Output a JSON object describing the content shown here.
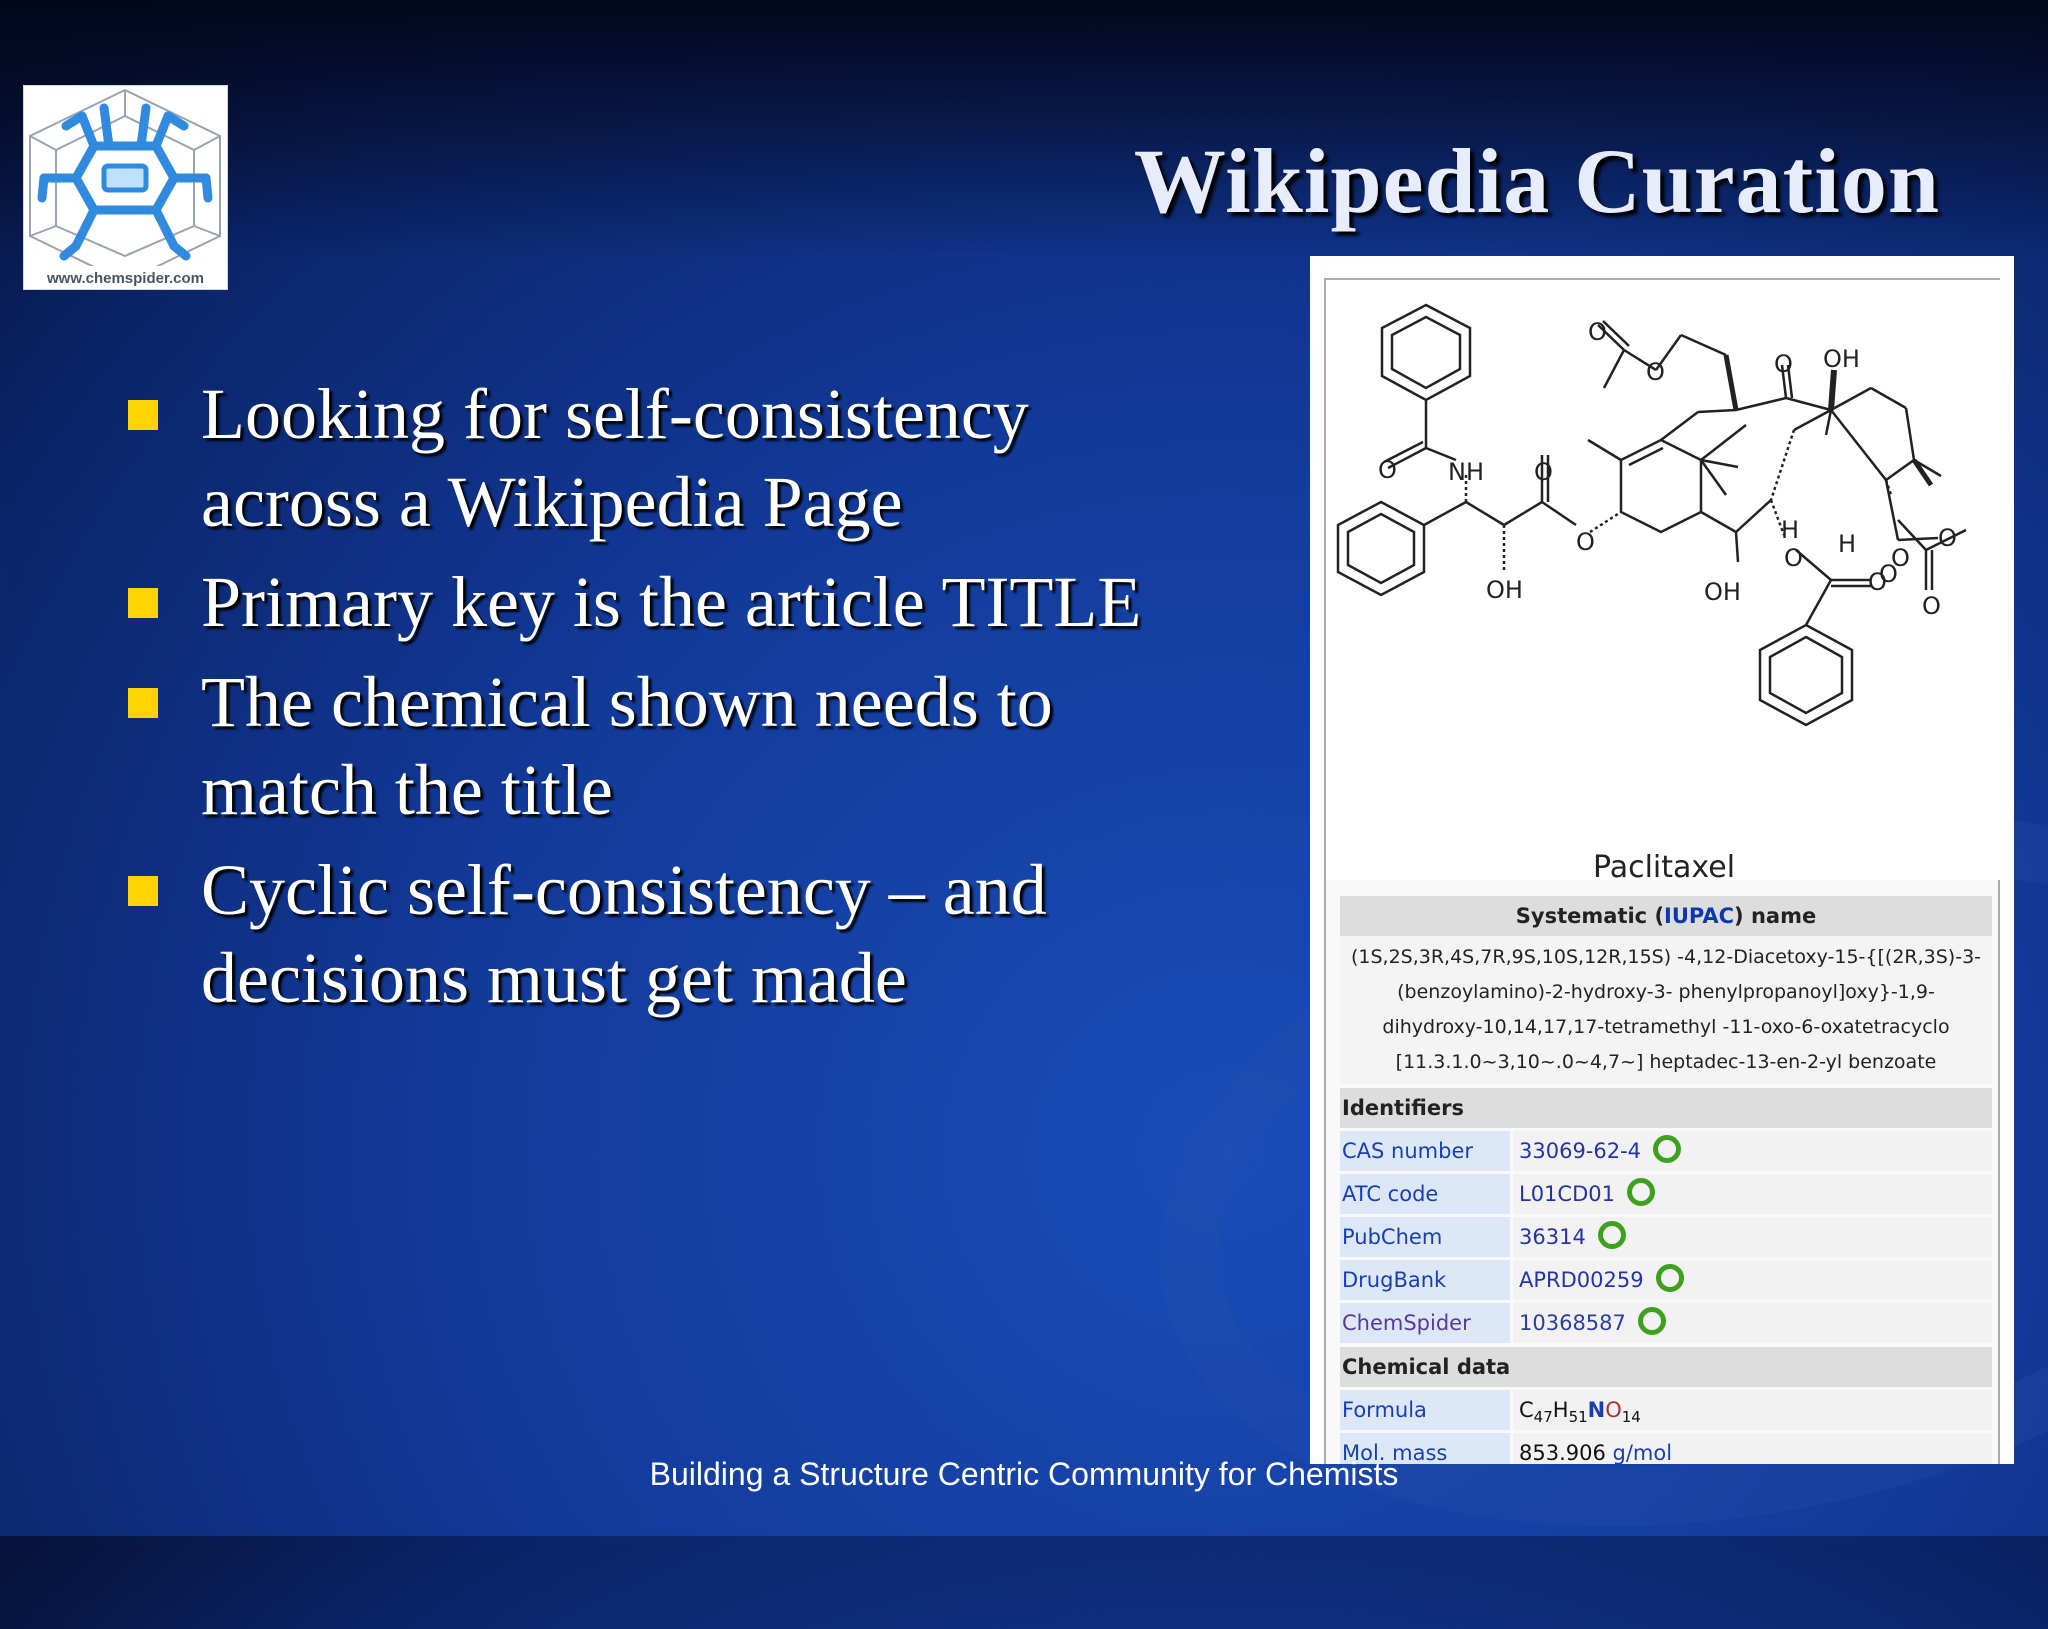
{
  "slide": {
    "title": "Wikipedia Curation",
    "logo_caption": "www.chemspider.com",
    "bullets": [
      "Looking for self-consistency across a Wikipedia Page",
      "Primary key is the article TITLE",
      "The chemical shown needs to match the title",
      "Cyclic self-consistency – and decisions must get made"
    ],
    "footer": "Building a Structure Centric Community for Chemists"
  },
  "wiki": {
    "compound_name": "Paclitaxel",
    "systematic_header_prefix": "Systematic (",
    "systematic_header_link": "IUPAC",
    "systematic_header_suffix": ") name",
    "iupac_name": "(1S,2S,3R,4S,7R,9S,10S,12R,15S) -4,12-Diacetoxy-15-{[(2R,3S)-3-(benzoylamino)-2-hydroxy-3- phenylpropanoyl]oxy}-1,9- dihydroxy-10,14,17,17-tetramethyl -11-oxo-6-oxatetracyclo [11.3.1.0~3,10~.0~4,7~] heptadec-13-en-2-yl benzoate",
    "identifiers_header": "Identifiers",
    "identifiers": [
      {
        "key": "CAS number",
        "value": "33069-62-4"
      },
      {
        "key": "ATC code",
        "value": "L01CD01"
      },
      {
        "key": "PubChem",
        "value": "36314"
      },
      {
        "key": "DrugBank",
        "value": "APRD00259"
      },
      {
        "key": "ChemSpider",
        "value": "10368587"
      }
    ],
    "chemical_header": "Chemical data",
    "formula_key": "Formula",
    "formula": {
      "c": "C",
      "c_n": "47",
      "h": "H",
      "h_n": "51",
      "n": "N",
      "o": "O",
      "o_n": "14"
    },
    "mass_key": "Mol. mass",
    "mass_value": "853.906",
    "mass_unit": "g/mol",
    "atom_labels": [
      "O",
      "NH",
      "O",
      "OH",
      "O",
      "O",
      "O",
      "OH",
      "O",
      "H",
      "O",
      "OH",
      "H",
      "O",
      "O",
      "O",
      "O",
      "O"
    ]
  },
  "colors": {
    "accent_bullet": "#ffd400",
    "check": "#3da11f",
    "link": "#1a3fb5"
  }
}
